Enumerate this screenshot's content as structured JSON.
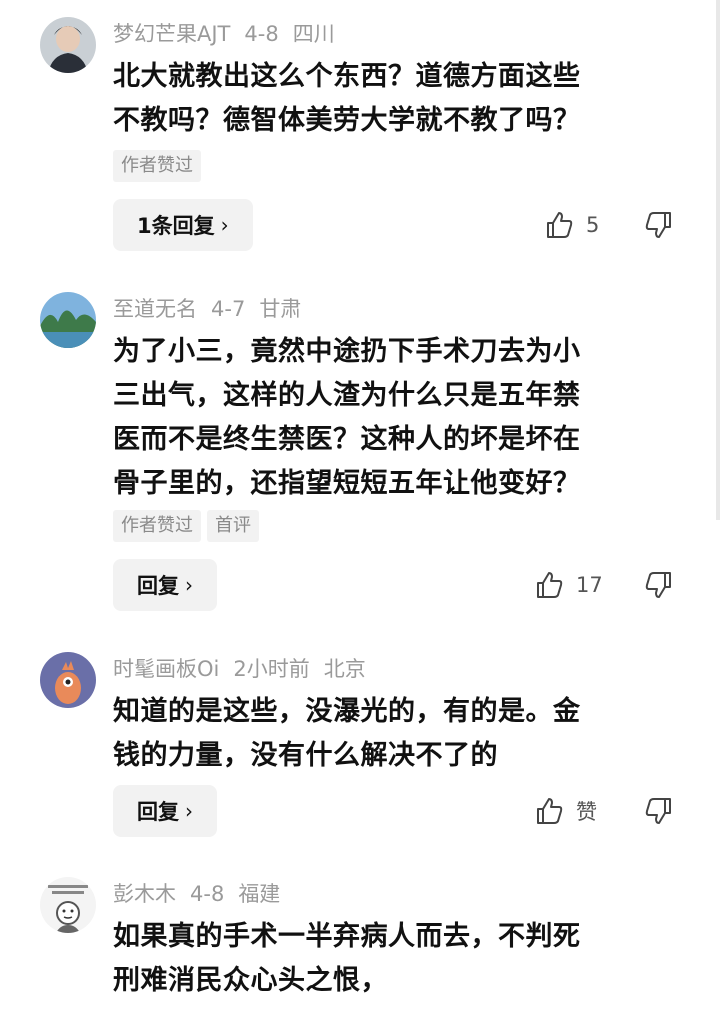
{
  "comments": [
    {
      "user": "梦幻芒果AJT",
      "date": "4-8",
      "location": "四川",
      "text_lines": [
        "北大就教出这么个东西？道德方面这些",
        "不教吗？德智体美劳大学就不教了吗？"
      ],
      "tags": [
        "作者赞过"
      ],
      "reply_label": "1条回复",
      "likes": "5"
    },
    {
      "user": "至道无名",
      "date": "4-7",
      "location": "甘肃",
      "text_lines": [
        "为了小三，竟然中途扔下手术刀去为小",
        "三出气，这样的人渣为什么只是五年禁",
        "医而不是终生禁医？这种人的坏是坏在",
        "骨子里的，还指望短短五年让他变好？"
      ],
      "tags": [
        "作者赞过",
        "首评"
      ],
      "reply_label": "回复",
      "likes": "17"
    },
    {
      "user": "时髦画板Oi",
      "date": "2小时前",
      "location": "北京",
      "text_lines": [
        "知道的是这些，没瀑光的，有的是。金",
        "钱的力量，没有什么解决不了的"
      ],
      "tags": [],
      "reply_label": "回复",
      "likes": "赞"
    },
    {
      "user": "彭木木",
      "date": "4-8",
      "location": "福建",
      "text_lines": [
        "如果真的手术一半弃病人而去，不判死",
        "刑难消民众心头之恨，"
      ],
      "tags": [],
      "reply_label": "",
      "likes": ""
    }
  ],
  "icons": {
    "like": "thumbs-up-icon",
    "dislike": "thumbs-down-icon",
    "chevron": "chevron-right-icon"
  },
  "colors": {
    "meta": "#9a9a9a",
    "tag_bg": "#f2f2f2",
    "text": "#111111"
  }
}
